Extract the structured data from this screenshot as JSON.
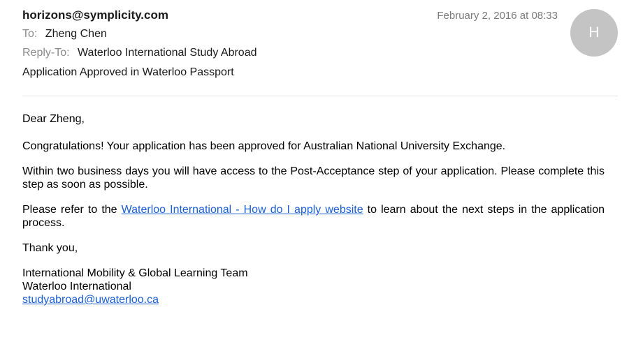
{
  "header": {
    "from": "horizons@symplicity.com",
    "date": "February 2, 2016 at 08:33",
    "avatar_initial": "H",
    "to_label": "To:",
    "to_value": "Zheng Chen",
    "reply_to_label": "Reply-To:",
    "reply_to_value": "Waterloo International Study Abroad",
    "subject": "Application Approved in Waterloo Passport"
  },
  "message": {
    "greeting": "Dear Zheng,",
    "congrats": "Congratulations! Your application has been approved for Australian National University Exchange.",
    "within": "Within two business days you will have access to the Post-Acceptance step of your application.  Please complete this step as soon as possible.",
    "refer_before": "Please refer to the ",
    "refer_link": "Waterloo International - How do I apply website",
    "refer_after": " to learn about the next steps in the application process.",
    "thanks": "Thank you,",
    "sig_team": "International Mobility & Global Learning Team",
    "sig_org": "Waterloo International",
    "sig_email": "studyabroad@uwaterloo.ca"
  },
  "colors": {
    "link": "#1a5fd6",
    "avatar_bg": "#c4c4c4",
    "muted_label": "#8a8a8a"
  }
}
